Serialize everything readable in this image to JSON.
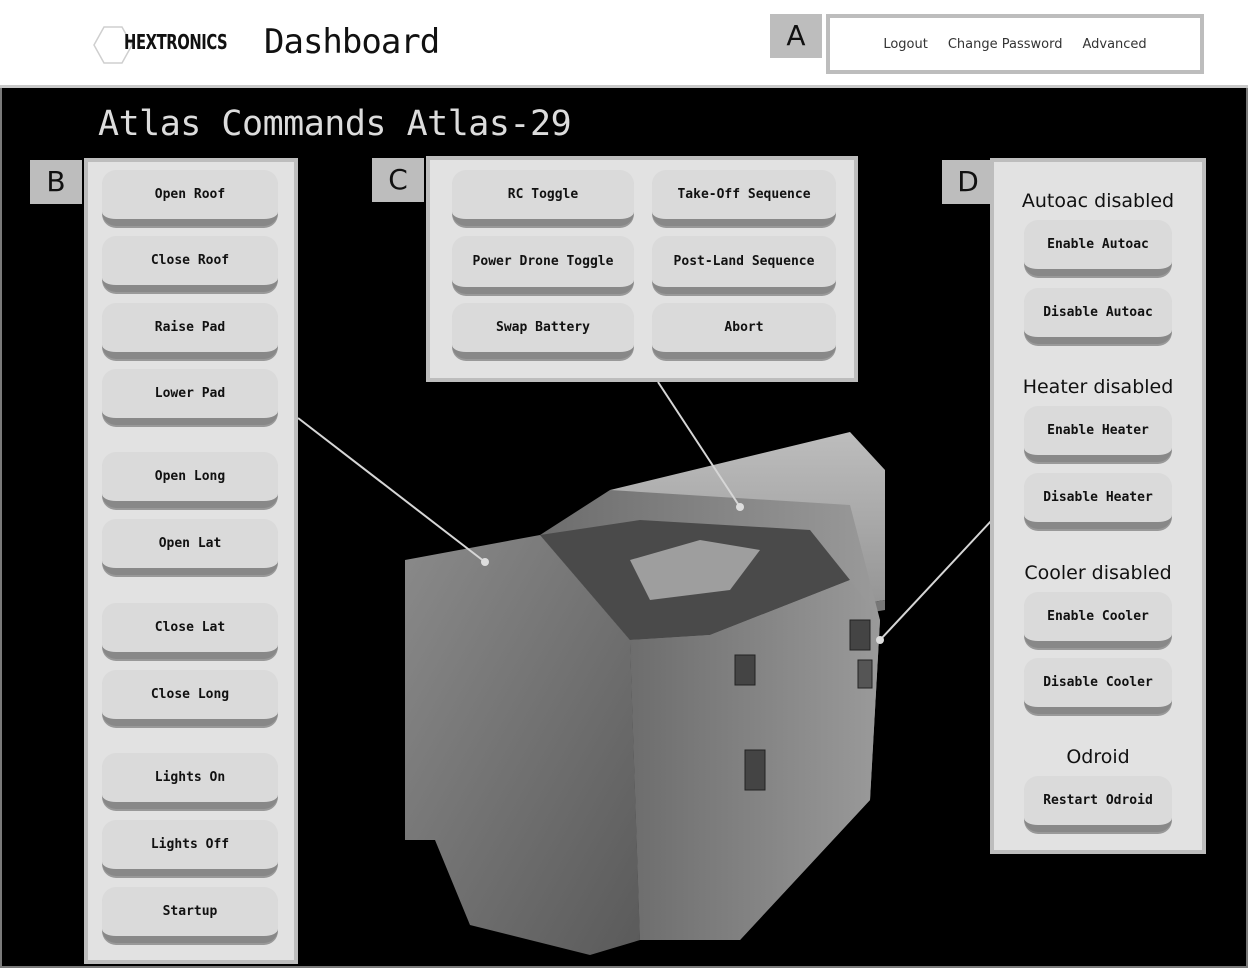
{
  "header": {
    "logo_text": "HEXTRONICS",
    "title": "Dashboard",
    "nav": [
      "Logout",
      "Change Password",
      "Advanced"
    ]
  },
  "page_title": "Atlas Commands Atlas-29",
  "tags": {
    "a": "A",
    "b": "B",
    "c": "C",
    "d": "D"
  },
  "panel_b": {
    "buttons": [
      "Open Roof",
      "Close Roof",
      "Raise Pad",
      "Lower Pad",
      "Open Long",
      "Open Lat",
      "Close Lat",
      "Close Long",
      "Lights On",
      "Lights Off",
      "Startup"
    ]
  },
  "panel_c": {
    "buttons": [
      "RC Toggle",
      "Take-Off Sequence",
      "Power Drone Toggle",
      "Post-Land Sequence",
      "Swap Battery",
      "Abort"
    ]
  },
  "panel_d": {
    "autoac_status": "Autoac disabled",
    "enable_autoac": "Enable Autoac",
    "disable_autoac": "Disable Autoac",
    "heater_status": "Heater disabled",
    "enable_heater": "Enable Heater",
    "disable_heater": "Disable Heater",
    "cooler_status": "Cooler disabled",
    "enable_cooler": "Enable Cooler",
    "disable_cooler": "Disable Cooler",
    "odroid_label": "Odroid",
    "restart_odroid": "Restart Odroid"
  }
}
